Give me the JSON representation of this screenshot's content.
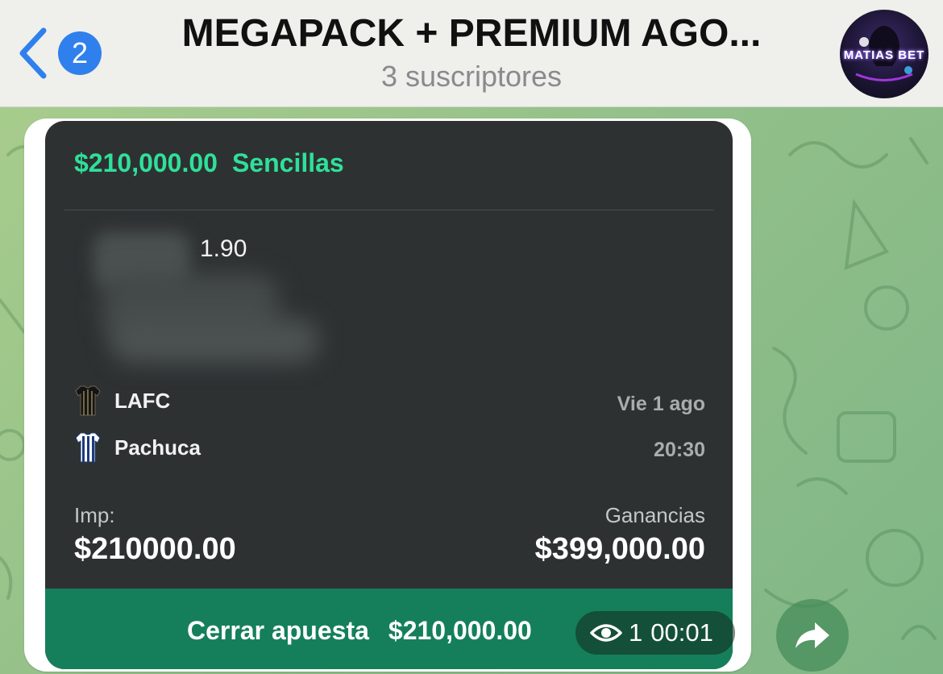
{
  "header": {
    "unread_count": "2",
    "channel_title": "MEGAPACK + PREMIUM AGO...",
    "subscribers": "3 suscriptores",
    "avatar_text": "MATIAS BET"
  },
  "bet_slip": {
    "amount": "$210,000.00",
    "type": "Sencillas",
    "odds": "1.90",
    "home_team": "LAFC",
    "away_team": "Pachuca",
    "date": "Vie 1 ago",
    "time": "20:30",
    "stake_label": "Imp:",
    "stake_value": "$210000.00",
    "winnings_label": "Ganancias",
    "winnings_value": "$399,000.00",
    "cashout_label": "Cerrar apuesta",
    "cashout_value": "$210,000.00"
  },
  "message_meta": {
    "views": "1",
    "time": "00:01"
  },
  "colors": {
    "accent_green": "#2fe09a",
    "cashout_green": "#157f5c",
    "badge_blue": "#2f80ed",
    "header_bg": "#efefeb"
  },
  "icons": {
    "back": "chevron-left-icon",
    "views": "eye-icon",
    "share": "share-arrow-icon"
  }
}
